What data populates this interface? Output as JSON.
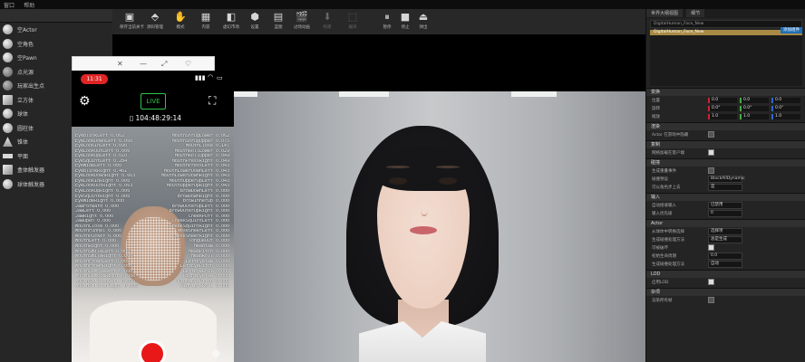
{
  "menubar": {
    "items": [
      "窗口",
      "帮助"
    ]
  },
  "left_panel": {
    "items": [
      {
        "label": "空Actor",
        "icon": "sphere-icon"
      },
      {
        "label": "空角色",
        "icon": "sphere-icon"
      },
      {
        "label": "空Pawn",
        "icon": "sphere-icon"
      },
      {
        "label": "点光源",
        "icon": "light-icon"
      },
      {
        "label": "玩家出生点",
        "icon": "player-start-icon"
      },
      {
        "label": "立方体",
        "icon": "cube-icon"
      },
      {
        "label": "球体",
        "icon": "sphere-icon"
      },
      {
        "label": "圆柱体",
        "icon": "cylinder-icon"
      },
      {
        "label": "锥体",
        "icon": "cone-icon"
      },
      {
        "label": "平面",
        "icon": "plane-icon"
      },
      {
        "label": "盒体触发器",
        "icon": "box-trigger-icon"
      },
      {
        "label": "球体触发器",
        "icon": "sphere-trigger-icon"
      }
    ]
  },
  "toolbar": {
    "buttons": [
      {
        "label": "保存当前关卡",
        "icon": "save-icon",
        "enabled": true
      },
      {
        "label": "源码管理",
        "icon": "source-control-icon",
        "enabled": true
      },
      {
        "label": "模式",
        "icon": "modes-icon",
        "enabled": true
      },
      {
        "label": "内容",
        "icon": "content-icon",
        "enabled": true
      },
      {
        "label": "虚幻市场",
        "icon": "marketplace-icon",
        "enabled": true
      },
      {
        "label": "设置",
        "icon": "settings-icon",
        "enabled": true
      },
      {
        "label": "蓝图",
        "icon": "blueprint-icon",
        "enabled": true
      },
      {
        "label": "过场动画",
        "icon": "cinematics-icon",
        "enabled": true
      },
      {
        "label": "构建",
        "icon": "build-icon",
        "enabled": false
      },
      {
        "label": "编译",
        "icon": "compile-icon",
        "enabled": false
      },
      {
        "label": "暂停",
        "icon": "pause-icon",
        "enabled": true
      },
      {
        "label": "停止",
        "icon": "stop-icon",
        "enabled": true
      },
      {
        "label": "弹出",
        "icon": "eject-icon",
        "enabled": true
      }
    ]
  },
  "phone_window": {
    "controls": [
      "✕",
      "—",
      "⤢",
      "♡"
    ],
    "time": "11:31",
    "live_label": "LIVE",
    "timecode": "104:48:29:14",
    "blendshapes": [
      {
        "left": "EyeBlinkLeft 0.062",
        "right": "MouthShrugLower 0.062"
      },
      {
        "left": "EyeLookDownLeft 0.060",
        "right": "MouthShrugUpper 0.075"
      },
      {
        "left": "EyeLookInLeft 0.090",
        "right": "MouthClose 0.147"
      },
      {
        "left": "EyeLookOutLeft 0.000",
        "right": "MouthRollLower 0.029"
      },
      {
        "left": "EyeLookUpLeft 0.010",
        "right": "MouthRollUpper 0.049"
      },
      {
        "left": "EyeSquintLeft 0.284",
        "right": "MouthPressRight 0.049"
      },
      {
        "left": "EyeWideLeft 0.000",
        "right": "MouthPressLeft 0.043"
      },
      {
        "left": "EyeBlinkRight 0.461",
        "right": "MouthLowerDownLeft 0.043"
      },
      {
        "left": "EyeLookDownRight 0.063",
        "right": "MouthLowerDownRight 0.043"
      },
      {
        "left": "EyeLookInRight 0.000",
        "right": "MouthUpperUpLeft 0.043"
      },
      {
        "left": "EyeLookOutRight 0.063",
        "right": "MouthUpperUpRight 0.043"
      },
      {
        "left": "EyeLookUpRight 0.000",
        "right": "BrowDownLeft 0.000"
      },
      {
        "left": "EyeSquintRight 0.000",
        "right": "BrowDownRight 0.000"
      },
      {
        "left": "EyeWideRight 0.000",
        "right": "BrowInnerUp 0.000"
      },
      {
        "left": "JawForward 0.000",
        "right": "BrowOuterUpLeft 0.000"
      },
      {
        "left": "JawLeft 0.000",
        "right": "BrowOuterUpRight 0.000"
      },
      {
        "left": "JawRight 0.000",
        "right": "CheekPuff 0.000"
      },
      {
        "left": "JawOpen 0.000",
        "right": "CheekSquintLeft 0.000"
      },
      {
        "left": "MouthClose 0.000",
        "right": "CheekSquintRight 0.000"
      },
      {
        "left": "MouthFunnel 0.000",
        "right": "NoseSneerLeft 0.000"
      },
      {
        "left": "MouthPucker 0.000",
        "right": "NoseSneerRight 0.000"
      },
      {
        "left": "MouthLeft 0.000",
        "right": "TongueOut 0.000"
      },
      {
        "left": "MouthRight 0.000",
        "right": "HeadYaw 0.000"
      },
      {
        "left": "MouthSmileLeft 0.000",
        "right": "HeadPitch 0.000"
      },
      {
        "left": "MouthSmileRight 0.000",
        "right": "HeadRoll 0.000"
      },
      {
        "left": "MouthFrownLeft 0.000",
        "right": "LeftEyeYaw 0.000"
      },
      {
        "left": "MouthFrownRight 0.000",
        "right": "LeftEyePitch 0.000"
      },
      {
        "left": "MouthDimpleLeft 0.000",
        "right": "LeftEyeRoll 0.000"
      },
      {
        "left": "MouthDimpleRight 0.000",
        "right": "RightEyeYaw 0.000"
      },
      {
        "left": "MouthStretchLeft 0.000",
        "right": "RightEyePitch 0.000"
      },
      {
        "left": "MouthStretchRight 0.000",
        "right": "RightEyeRoll 0.000"
      },
      {
        "left": "",
        "right": ""
      }
    ]
  },
  "right_panel": {
    "tabs": [
      "世界大纲视图",
      "细节"
    ],
    "search_value": "DigitalHuman_Face_New",
    "blue_button": "添加组件",
    "tree_rows": [
      "DigitalHuman_Face_New",
      "",
      "",
      "",
      "",
      "",
      "",
      ""
    ],
    "transform_rows": [
      {
        "name": "位置",
        "x": "0.0",
        "y": "0.0",
        "z": "0.0"
      },
      {
        "name": "旋转",
        "x": "0.0°",
        "y": "0.0°",
        "z": "0.0°"
      },
      {
        "name": "缩放",
        "x": "1.0",
        "y": "1.0",
        "z": "1.0"
      }
    ],
    "sections": [
      {
        "title": "渲染",
        "rows": [
          {
            "name": "Actor 在游戏中隐藏",
            "type": "check",
            "on": false
          }
        ]
      },
      {
        "title": "复制",
        "rows": [
          {
            "name": "网络加载在客户端",
            "type": "check",
            "on": true
          }
        ]
      },
      {
        "title": "碰撞",
        "rows": [
          {
            "name": "生成重叠事件",
            "type": "check",
            "on": false
          },
          {
            "name": "碰撞预设",
            "type": "dropdown",
            "value": "BlockAllDynamic"
          },
          {
            "name": "可以角色步上去",
            "type": "dropdown",
            "value": "是"
          }
        ]
      },
      {
        "title": "输入",
        "rows": [
          {
            "name": "自动接收输入",
            "type": "dropdown",
            "value": "已禁用"
          },
          {
            "name": "输入优先级",
            "type": "dropdown",
            "value": "0"
          }
        ]
      },
      {
        "title": "Actor",
        "rows": [
          {
            "name": "从球体中转换选择",
            "type": "dropdown",
            "value": "选择项"
          },
          {
            "name": "生成碰撞处理方法",
            "type": "dropdown",
            "value": "总是生成"
          },
          {
            "name": "可被破坏",
            "type": "check",
            "on": true
          },
          {
            "name": "初始生命周期",
            "type": "dropdown",
            "value": "0.0"
          },
          {
            "name": "生成碰撞处理方法",
            "type": "dropdown",
            "value": "自动"
          }
        ]
      },
      {
        "title": "LOD",
        "rows": [
          {
            "name": "启用LOD",
            "type": "check",
            "on": true
          }
        ]
      },
      {
        "title": "杂项",
        "rows": [
          {
            "name": "渲染所有帧",
            "type": "check",
            "on": false
          }
        ]
      }
    ]
  }
}
